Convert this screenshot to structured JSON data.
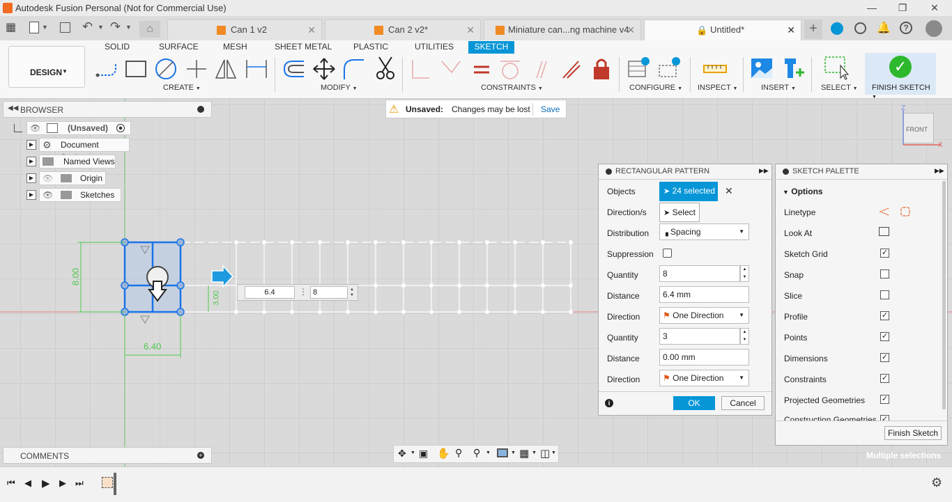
{
  "app": {
    "title": "Autodesk Fusion Personal (Not for Commercial Use)"
  },
  "doc_tabs": [
    {
      "label": "Can 1 v2"
    },
    {
      "label": "Can 2 v2*"
    },
    {
      "label": "Miniature can...ng machine v4"
    },
    {
      "label": "Untitled*"
    }
  ],
  "ribbon": {
    "workspace": "DESIGN",
    "tabs": [
      "SOLID",
      "SURFACE",
      "MESH",
      "SHEET METAL",
      "PLASTIC",
      "UTILITIES",
      "SKETCH"
    ],
    "groups": {
      "create": "CREATE",
      "modify": "MODIFY",
      "constraints": "CONSTRAINTS",
      "configure": "CONFIGURE",
      "inspect": "INSPECT",
      "insert": "INSERT",
      "select": "SELECT",
      "finish": "FINISH SKETCH"
    }
  },
  "browser": {
    "title": "BROWSER",
    "root": "(Unsaved)",
    "items": [
      "Document Settings",
      "Named Views",
      "Origin",
      "Sketches"
    ]
  },
  "unsaved": {
    "label": "Unsaved:",
    "message": "Changes may be lost",
    "save": "Save"
  },
  "viewcube": {
    "face": "FRONT",
    "z": "Z",
    "x": "X"
  },
  "sketch": {
    "dim_vertical": "8.00",
    "dim_horizontal": "6.40",
    "dim_small": "3.00",
    "input_distance": "6.4",
    "input_quantity": "8"
  },
  "pattern": {
    "title": "RECTANGULAR PATTERN",
    "objects_label": "Objects",
    "objects_value": "24 selected",
    "direction_label": "Direction/s",
    "direction_value": "Select",
    "distribution_label": "Distribution",
    "distribution_value": "Spacing",
    "suppression_label": "Suppression",
    "quantity1_label": "Quantity",
    "quantity1_value": "8",
    "distance1_label": "Distance",
    "distance1_value": "6.4 mm",
    "direction1_label": "Direction",
    "direction1_value": "One Direction",
    "quantity2_label": "Quantity",
    "quantity2_value": "3",
    "distance2_label": "Distance",
    "distance2_value": "0.00 mm",
    "direction2_label": "Direction",
    "direction2_value": "One Direction",
    "ok": "OK",
    "cancel": "Cancel"
  },
  "palette": {
    "title": "SKETCH PALETTE",
    "section": "Options",
    "rows": [
      {
        "label": "Linetype"
      },
      {
        "label": "Look At"
      },
      {
        "label": "Sketch Grid",
        "checked": true
      },
      {
        "label": "Snap",
        "checked": false
      },
      {
        "label": "Slice",
        "checked": false
      },
      {
        "label": "Profile",
        "checked": true
      },
      {
        "label": "Points",
        "checked": true
      },
      {
        "label": "Dimensions",
        "checked": true
      },
      {
        "label": "Constraints",
        "checked": true
      },
      {
        "label": "Projected Geometries",
        "checked": true
      },
      {
        "label": "Construction Geometries",
        "checked": true
      }
    ],
    "finish": "Finish Sketch"
  },
  "comments": {
    "title": "COMMENTS"
  },
  "status": {
    "text": "Multiple selections"
  },
  "colors": {
    "accent": "#0696d7",
    "finish_green": "#2eb82e",
    "sketch_line": "#ffffff",
    "sketch_selected": "#1a73e8",
    "dim_green": "#4ec94e"
  }
}
